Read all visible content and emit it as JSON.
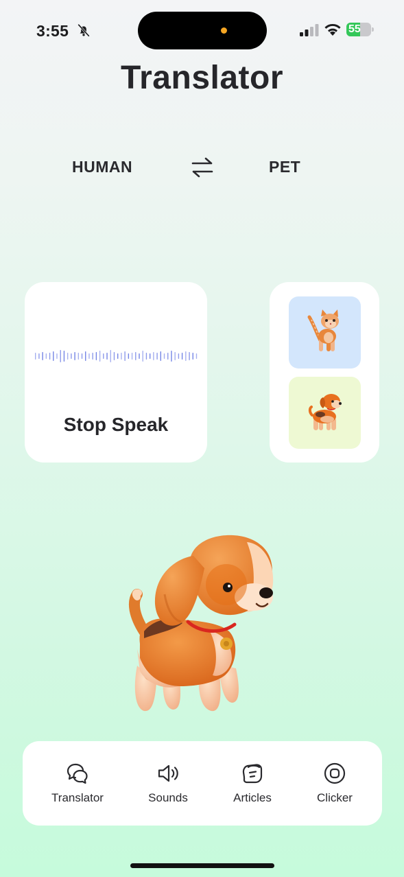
{
  "status_bar": {
    "time": "3:55",
    "battery_percent": 55,
    "battery_label": "55",
    "icons": [
      "bell-slash-icon",
      "cellular-signal-icon",
      "wifi-icon",
      "battery-icon"
    ]
  },
  "header": {
    "title": "Translator"
  },
  "language_switch": {
    "from": "HUMAN",
    "to": "PET",
    "swap_icon": "swap-arrows-icon"
  },
  "speak_card": {
    "label": "Stop Speak"
  },
  "pet_selector": {
    "options": [
      "cat",
      "dog"
    ]
  },
  "tab_bar": {
    "tabs": [
      {
        "label": "Translator",
        "icon": "chat-bubbles-icon"
      },
      {
        "label": "Sounds",
        "icon": "speaker-icon"
      },
      {
        "label": "Articles",
        "icon": "document-icon"
      },
      {
        "label": "Clicker",
        "icon": "clicker-icon"
      }
    ]
  },
  "colors": {
    "waveform": "#5b6ee1",
    "cat_tile": "#d3e6fc",
    "dog_tile": "#eef9d3",
    "battery_fill": "#34c759",
    "accent_orange": "#e8701f"
  }
}
